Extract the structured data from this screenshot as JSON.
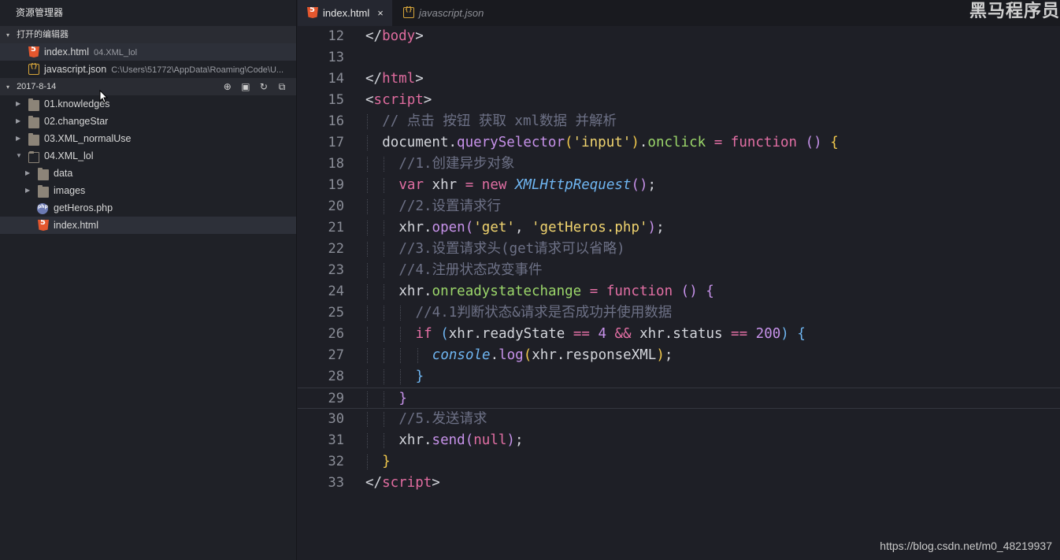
{
  "sidebar": {
    "title": "资源管理器",
    "open_editors": {
      "label": "打开的编辑器",
      "items": [
        {
          "name": "index.html",
          "desc": "04.XML_lol"
        },
        {
          "name": "javascript.json",
          "desc": "C:\\Users\\51772\\AppData\\Roaming\\Code\\U..."
        }
      ]
    },
    "workspace": {
      "label": "2017-8-14",
      "tree": [
        {
          "label": "01.knowledges"
        },
        {
          "label": "02.changeStar"
        },
        {
          "label": "03.XML_normalUse"
        },
        {
          "label": "04.XML_lol"
        },
        {
          "label": "data"
        },
        {
          "label": "images"
        },
        {
          "label": "getHeros.php"
        },
        {
          "label": "index.html"
        }
      ]
    }
  },
  "tabs": [
    {
      "label": "index.html",
      "close": "×"
    },
    {
      "label": "javascript.json"
    }
  ],
  "brand_watermark": "黑马程序员",
  "url_watermark": "https://blog.csdn.net/m0_48219937",
  "editor": {
    "line_numbers": [
      "12",
      "13",
      "14",
      "15",
      "16",
      "17",
      "18",
      "19",
      "20",
      "21",
      "22",
      "23",
      "24",
      "25",
      "26",
      "27",
      "28",
      "29",
      "30",
      "31",
      "32",
      "33"
    ],
    "lines": {
      "l12": [
        "</",
        "body",
        ">"
      ],
      "l14": [
        "</",
        "html",
        ">"
      ],
      "l15": [
        "<",
        "script",
        ">"
      ],
      "l16": "// 点击 按钮 获取 xml数据 并解析",
      "l17": [
        "document",
        ".",
        "querySelector",
        "(",
        "'input'",
        ")",
        ".",
        "onclick",
        " = ",
        "function",
        " ",
        "()",
        " ",
        "{"
      ],
      "l18": "//1.创建异步对象",
      "l19": [
        "var",
        " xhr ",
        "=",
        " ",
        "new",
        " ",
        "XMLHttpRequest",
        "()",
        ";"
      ],
      "l20": "//2.设置请求行",
      "l21": [
        "xhr",
        ".",
        "open",
        "(",
        "'get'",
        ", ",
        "'getHeros.php'",
        ")",
        ";"
      ],
      "l22": "//3.设置请求头(get请求可以省略)",
      "l23": "//4.注册状态改变事件",
      "l24": [
        "xhr",
        ".",
        "onreadystatechange",
        " = ",
        "function",
        " ",
        "()",
        " ",
        "{"
      ],
      "l25": "//4.1判断状态&请求是否成功并使用数据",
      "l26": [
        "if",
        " ",
        "(",
        "xhr",
        ".",
        "readyState",
        " == ",
        "4",
        " && ",
        "xhr",
        ".",
        "status",
        " == ",
        "200",
        ")",
        " ",
        "{"
      ],
      "l27": [
        "console",
        ".",
        "log",
        "(",
        "xhr",
        ".",
        "responseXML",
        ")",
        ";"
      ],
      "l28": "}",
      "l29": "}",
      "l30": "//5.发送请求",
      "l31": [
        "xhr",
        ".",
        "send",
        "(",
        "null",
        ")",
        ";"
      ],
      "l32": "}",
      "l33": [
        "</",
        "script",
        ">"
      ]
    }
  }
}
